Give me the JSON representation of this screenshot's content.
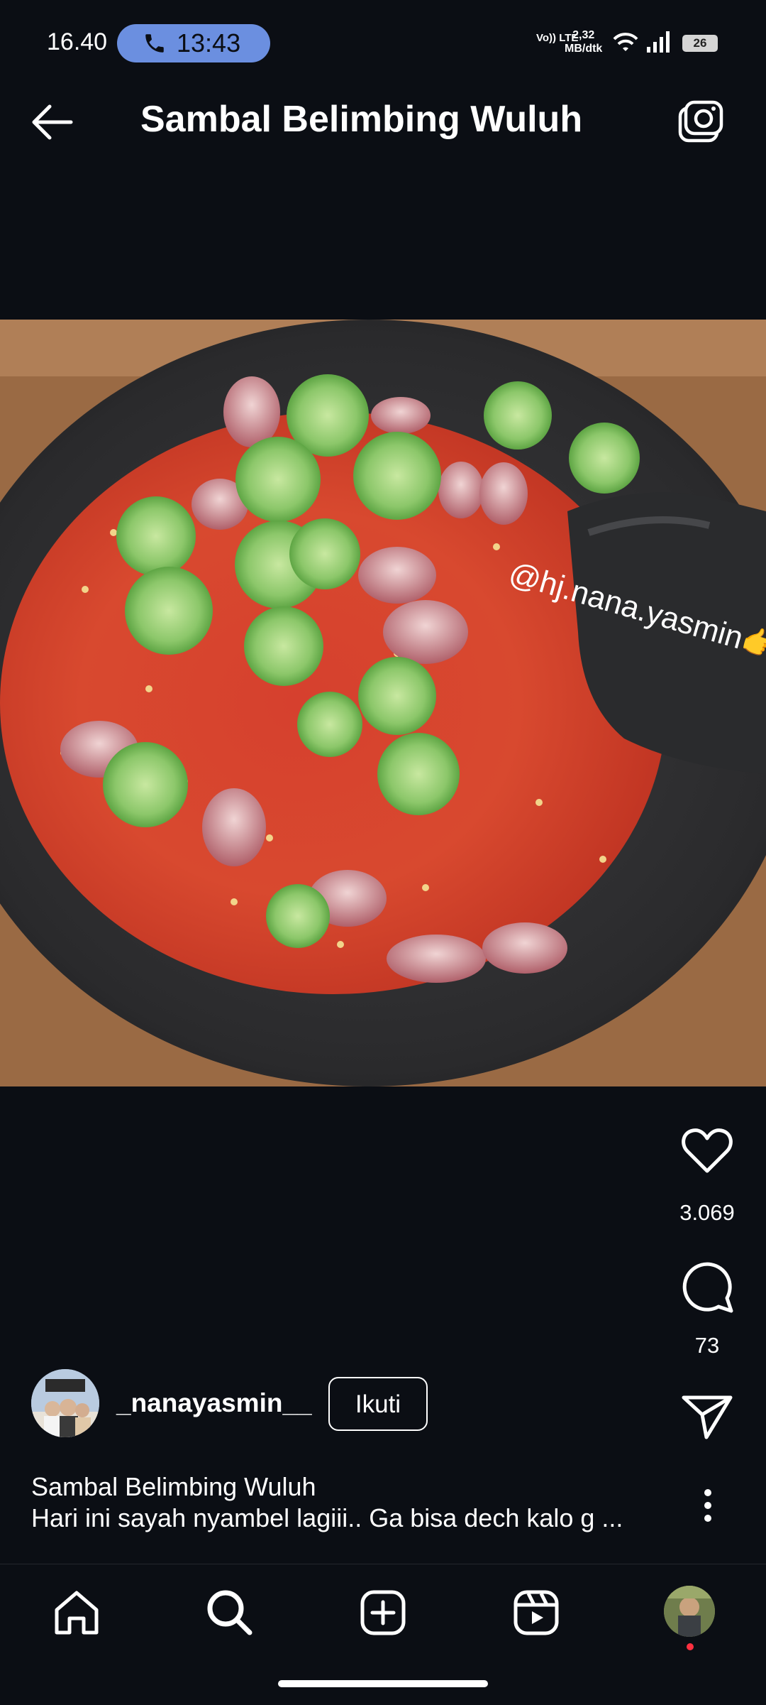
{
  "status_bar": {
    "clock": "16.40",
    "call_timer": "13:43",
    "volte_label": "Vo)) LTE",
    "net_speed_value": "2,32",
    "net_speed_unit": "MB/dtk",
    "battery_level": "26"
  },
  "header": {
    "title": "Sambal Belimbing Wuluh",
    "back_icon": "arrow-left-icon",
    "camera_icon": "camera-icon"
  },
  "post": {
    "watermark": "@hj.nana.yasmin👉New",
    "likes": "3.069",
    "comments": "73",
    "author": "_nanayasmin__",
    "follow_label": "Ikuti",
    "caption_title": "Sambal Belimbing Wuluh",
    "caption_text": "Hari ini  sayah nyambel lagiii.. Ga bisa dech kalo g ..."
  },
  "icons": {
    "like": "heart-icon",
    "comment": "comment-bubble-icon",
    "share": "paper-plane-icon",
    "more": "more-vertical-icon"
  },
  "bottom_nav": [
    "home-icon",
    "search-icon",
    "create-plus-icon",
    "reels-icon",
    "profile-avatar"
  ],
  "colors": {
    "background": "#0b0e14",
    "call_pill": "#6b8fe0",
    "notification_dot": "#ff3040"
  }
}
